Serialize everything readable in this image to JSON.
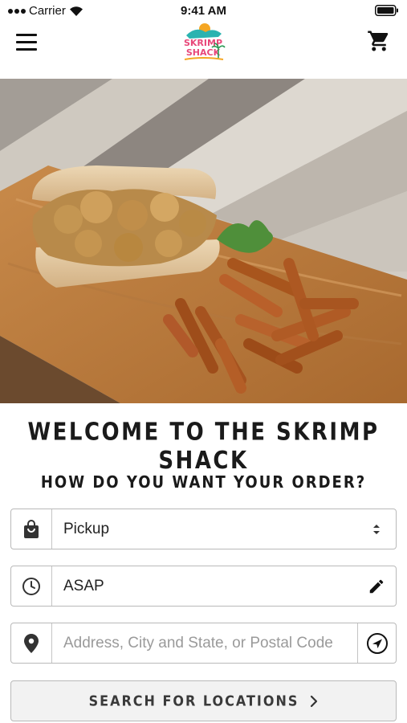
{
  "status_bar": {
    "carrier": "Carrier",
    "time": "9:41 AM"
  },
  "header": {
    "logo_text_top": "SKRIMP",
    "logo_text_bottom": "SHACK"
  },
  "welcome": {
    "title": "WELCOME TO THE SKRIMP SHACK",
    "question": "HOW DO YOU WANT YOUR ORDER?"
  },
  "order_type": {
    "selected": "Pickup"
  },
  "time": {
    "value": "ASAP"
  },
  "location": {
    "placeholder": "Address, City and State, or Postal Code"
  },
  "search": {
    "label": "SEARCH FOR LOCATIONS"
  },
  "colors": {
    "accent_teal": "#2bb3b0",
    "logo_pink": "#e8487a",
    "logo_orange": "#f5a623"
  }
}
